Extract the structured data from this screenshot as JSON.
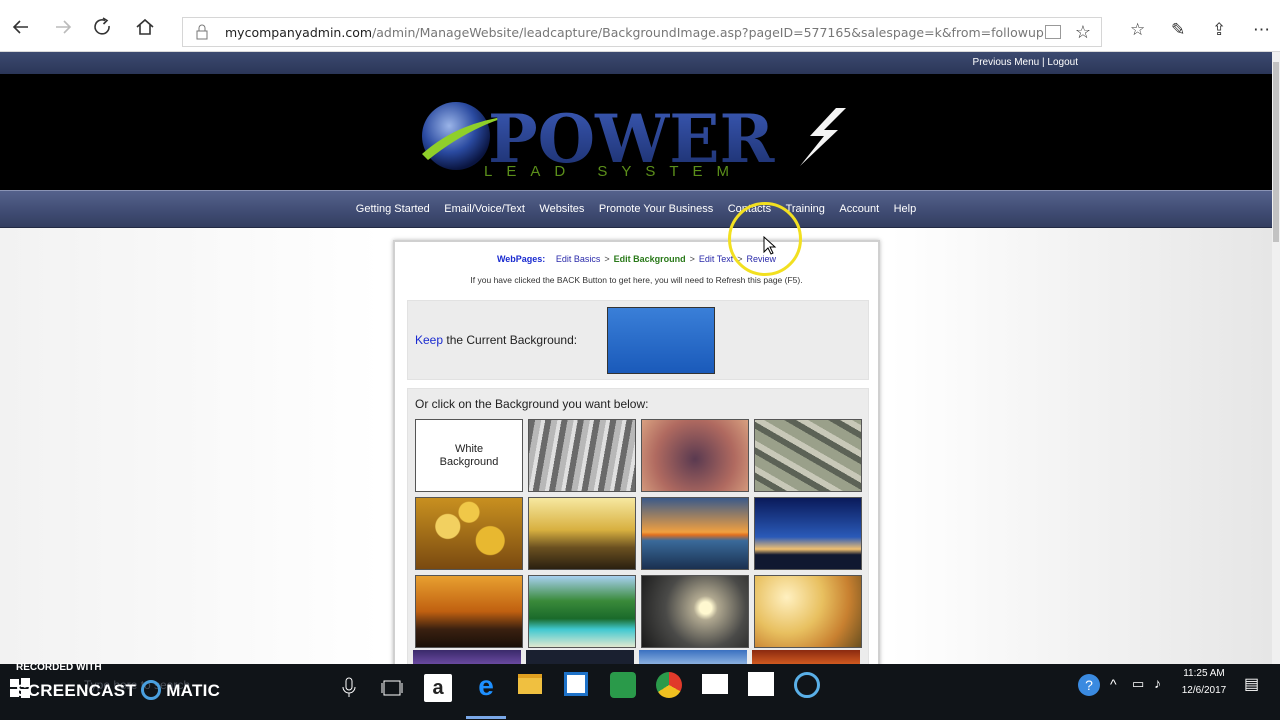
{
  "browser": {
    "url_domain": "mycompanyadmin.com",
    "url_path": "/admin/ManageWebsite/leadcapture/BackgroundImage.asp?pageID=577165&salespage=k&from=followup"
  },
  "site": {
    "topbar_links": "Previous Menu | Logout",
    "logo_main": "POWER",
    "logo_sub": "LEAD SYSTEM",
    "nav": [
      "Getting Started",
      "Email/Voice/Text",
      "Websites",
      "Promote Your Business",
      "Contacts",
      "Training",
      "Account",
      "Help"
    ]
  },
  "breadcrumb": {
    "lead": "WebPages:",
    "items": [
      "Edit Basics",
      "Edit Background",
      "Edit Text",
      "Review"
    ],
    "separator": ">"
  },
  "back_note": "If you have clicked the BACK Button to get here, you will need to Refresh this page (F5).",
  "keep": {
    "keyword": "Keep",
    "rest": " the Current Background:"
  },
  "choose_label": "Or click on the Background you want below:",
  "thumbs": {
    "white_label_1": "White",
    "white_label_2": "Background"
  },
  "watermark": {
    "line1": "RECORDED WITH",
    "line2": "SCREENCAST",
    "line3": "MATIC"
  },
  "taskbar": {
    "search_placeholder": "Type here to search",
    "time": "11:25 AM",
    "date": "12/6/2017"
  },
  "colors": {
    "nav_bg": "#4a5680",
    "accent_link": "#1a2bd0",
    "current_step": "#2a7a1a"
  }
}
